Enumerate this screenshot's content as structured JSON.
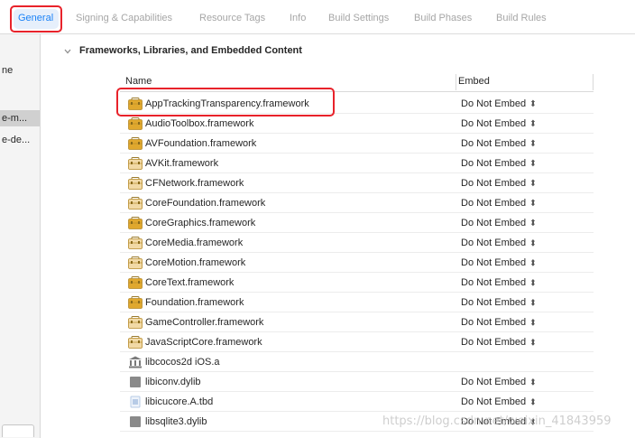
{
  "tabs": [
    {
      "label": "General",
      "active": true
    },
    {
      "label": "Signing & Capabilities",
      "active": false
    },
    {
      "label": "Resource Tags",
      "active": false
    },
    {
      "label": "Info",
      "active": false
    },
    {
      "label": "Build Settings",
      "active": false
    },
    {
      "label": "Build Phases",
      "active": false
    },
    {
      "label": "Build Rules",
      "active": false
    }
  ],
  "sidebar": {
    "items": [
      "ne",
      "e-m...",
      "e-de..."
    ]
  },
  "section": {
    "title": "Frameworks, Libraries, and Embedded Content"
  },
  "table": {
    "headers": {
      "name": "Name",
      "embed": "Embed"
    },
    "rows": [
      {
        "name": "AppTrackingTransparency.framework",
        "embed": "Do Not Embed",
        "icon": "framework-icon",
        "icon_color": "#e0a82e"
      },
      {
        "name": "AudioToolbox.framework",
        "embed": "Do Not Embed",
        "icon": "framework-icon",
        "icon_color": "#e0a82e"
      },
      {
        "name": "AVFoundation.framework",
        "embed": "Do Not Embed",
        "icon": "framework-icon",
        "icon_color": "#e0a82e"
      },
      {
        "name": "AVKit.framework",
        "embed": "Do Not Embed",
        "icon": "framework-icon",
        "icon_color": "#f1d9a6"
      },
      {
        "name": "CFNetwork.framework",
        "embed": "Do Not Embed",
        "icon": "framework-icon",
        "icon_color": "#f1d9a6"
      },
      {
        "name": "CoreFoundation.framework",
        "embed": "Do Not Embed",
        "icon": "framework-icon",
        "icon_color": "#f1d9a6"
      },
      {
        "name": "CoreGraphics.framework",
        "embed": "Do Not Embed",
        "icon": "framework-icon",
        "icon_color": "#e0a82e"
      },
      {
        "name": "CoreMedia.framework",
        "embed": "Do Not Embed",
        "icon": "framework-icon",
        "icon_color": "#f1d9a6"
      },
      {
        "name": "CoreMotion.framework",
        "embed": "Do Not Embed",
        "icon": "framework-icon",
        "icon_color": "#f1d9a6"
      },
      {
        "name": "CoreText.framework",
        "embed": "Do Not Embed",
        "icon": "framework-icon",
        "icon_color": "#e0a82e"
      },
      {
        "name": "Foundation.framework",
        "embed": "Do Not Embed",
        "icon": "framework-icon",
        "icon_color": "#e0a82e"
      },
      {
        "name": "GameController.framework",
        "embed": "Do Not Embed",
        "icon": "framework-icon",
        "icon_color": "#f1d9a6"
      },
      {
        "name": "JavaScriptCore.framework",
        "embed": "Do Not Embed",
        "icon": "framework-icon",
        "icon_color": "#f1d9a6"
      },
      {
        "name": "libcocos2d iOS.a",
        "embed": "",
        "icon": "library-icon",
        "icon_color": "#7a7a7a"
      },
      {
        "name": "libiconv.dylib",
        "embed": "Do Not Embed",
        "icon": "dylib-icon",
        "icon_color": "#8a8a8a"
      },
      {
        "name": "libicucore.A.tbd",
        "embed": "Do Not Embed",
        "icon": "tbd-icon",
        "icon_color": "#b7cbe6"
      },
      {
        "name": "libsqlite3.dylib",
        "embed": "Do Not Embed",
        "icon": "dylib-icon",
        "icon_color": "#8a8a8a"
      }
    ]
  },
  "watermark": "https://blog.csdn.net/weixin_41843959",
  "colors": {
    "accent": "#1a82f7",
    "highlight": "#e8222a"
  }
}
